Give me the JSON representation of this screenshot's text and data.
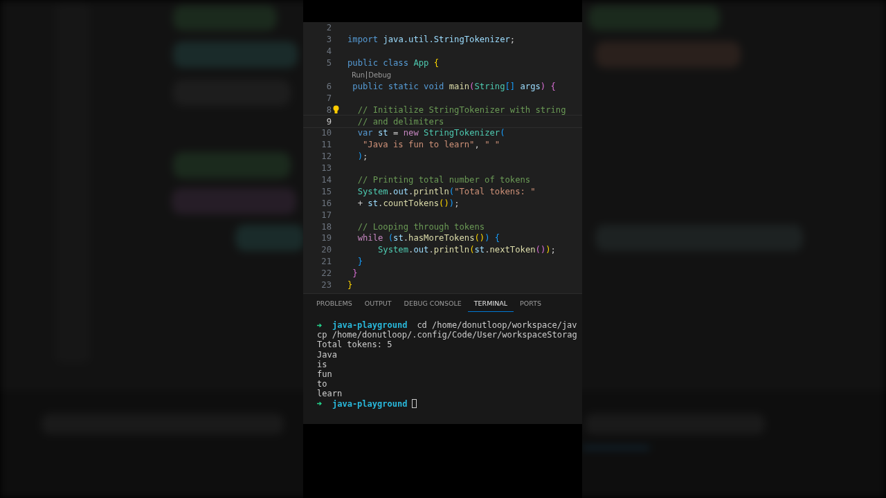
{
  "editor": {
    "lines": [
      {
        "number": "2",
        "current": false
      },
      {
        "number": "3",
        "current": false,
        "tokens": [
          {
            "kind": "keyword",
            "text": "import "
          },
          {
            "kind": "variable",
            "text": "java.util.StringTokenizer"
          },
          {
            "kind": "plain",
            "text": ";"
          }
        ]
      },
      {
        "number": "4",
        "current": false
      },
      {
        "number": "5",
        "current": false,
        "tokens": [
          {
            "kind": "keyword",
            "text": "public class "
          },
          {
            "kind": "class",
            "text": "App "
          },
          {
            "kind": "bracket1",
            "text": "{"
          }
        ]
      },
      {
        "number": "6",
        "current": false,
        "lens": [
          "Run",
          "Debug"
        ],
        "tokens": [
          {
            "kind": "keyword",
            "text": " public static void "
          },
          {
            "kind": "function",
            "text": "main"
          },
          {
            "kind": "bracket2",
            "text": "("
          },
          {
            "kind": "class",
            "text": "String"
          },
          {
            "kind": "bracket3",
            "text": "[] "
          },
          {
            "kind": "variable",
            "text": "args"
          },
          {
            "kind": "bracket2",
            "text": ") {"
          }
        ]
      },
      {
        "number": "7",
        "current": false
      },
      {
        "number": "8",
        "current": false,
        "hint": true,
        "tokens": [
          {
            "kind": "comment",
            "text": "  // Initialize StringTokenizer with string"
          }
        ]
      },
      {
        "number": "9",
        "current": true,
        "tokens": [
          {
            "kind": "comment",
            "text": "  // and delimiters"
          }
        ]
      },
      {
        "number": "10",
        "current": false,
        "tokens": [
          {
            "kind": "keyword",
            "text": "  var "
          },
          {
            "kind": "variable",
            "text": "st"
          },
          {
            "kind": "plain",
            "text": " = "
          },
          {
            "kind": "control",
            "text": "new "
          },
          {
            "kind": "class",
            "text": "StringTokenizer"
          },
          {
            "kind": "bracket3",
            "text": "("
          }
        ]
      },
      {
        "number": "11",
        "current": false,
        "tokens": [
          {
            "kind": "string",
            "text": "   \"Java is fun to learn\""
          },
          {
            "kind": "plain",
            "text": ", "
          },
          {
            "kind": "string",
            "text": "\" \""
          }
        ]
      },
      {
        "number": "12",
        "current": false,
        "tokens": [
          {
            "kind": "bracket3",
            "text": "  )"
          },
          {
            "kind": "plain",
            "text": ";"
          }
        ]
      },
      {
        "number": "13",
        "current": false
      },
      {
        "number": "14",
        "current": false,
        "tokens": [
          {
            "kind": "comment",
            "text": "  // Printing total number of tokens"
          }
        ]
      },
      {
        "number": "15",
        "current": false,
        "tokens": [
          {
            "kind": "class",
            "text": "  System"
          },
          {
            "kind": "plain",
            "text": "."
          },
          {
            "kind": "variable",
            "text": "out"
          },
          {
            "kind": "plain",
            "text": "."
          },
          {
            "kind": "function",
            "text": "println"
          },
          {
            "kind": "bracket3",
            "text": "("
          },
          {
            "kind": "string",
            "text": "\"Total tokens: \""
          }
        ]
      },
      {
        "number": "16",
        "current": false,
        "tokens": [
          {
            "kind": "plain",
            "text": "  + "
          },
          {
            "kind": "variable",
            "text": "st"
          },
          {
            "kind": "plain",
            "text": "."
          },
          {
            "kind": "function",
            "text": "countTokens"
          },
          {
            "kind": "bracket1",
            "text": "()"
          },
          {
            "kind": "bracket3",
            "text": ")"
          },
          {
            "kind": "plain",
            "text": ";"
          }
        ]
      },
      {
        "number": "17",
        "current": false
      },
      {
        "number": "18",
        "current": false,
        "tokens": [
          {
            "kind": "comment",
            "text": "  // Looping through tokens"
          }
        ]
      },
      {
        "number": "19",
        "current": false,
        "tokens": [
          {
            "kind": "control",
            "text": "  while "
          },
          {
            "kind": "bracket3",
            "text": "("
          },
          {
            "kind": "variable",
            "text": "st"
          },
          {
            "kind": "plain",
            "text": "."
          },
          {
            "kind": "function",
            "text": "hasMoreTokens"
          },
          {
            "kind": "bracket1",
            "text": "()"
          },
          {
            "kind": "bracket3",
            "text": ") {"
          }
        ]
      },
      {
        "number": "20",
        "current": false,
        "tokens": [
          {
            "kind": "class",
            "text": "      System"
          },
          {
            "kind": "plain",
            "text": "."
          },
          {
            "kind": "variable",
            "text": "out"
          },
          {
            "kind": "plain",
            "text": "."
          },
          {
            "kind": "function",
            "text": "println"
          },
          {
            "kind": "bracket1",
            "text": "("
          },
          {
            "kind": "variable",
            "text": "st"
          },
          {
            "kind": "plain",
            "text": "."
          },
          {
            "kind": "function",
            "text": "nextToken"
          },
          {
            "kind": "bracket2",
            "text": "()"
          },
          {
            "kind": "bracket1",
            "text": ")"
          },
          {
            "kind": "plain",
            "text": ";"
          }
        ]
      },
      {
        "number": "21",
        "current": false,
        "tokens": [
          {
            "kind": "bracket3",
            "text": "  }"
          }
        ]
      },
      {
        "number": "22",
        "current": false,
        "tokens": [
          {
            "kind": "bracket2",
            "text": " }"
          }
        ]
      },
      {
        "number": "23",
        "current": false,
        "tokens": [
          {
            "kind": "bracket1",
            "text": "}"
          }
        ]
      }
    ]
  },
  "panel": {
    "tabs": [
      {
        "label": "PROBLEMS",
        "selected": false
      },
      {
        "label": "OUTPUT",
        "selected": false
      },
      {
        "label": "DEBUG CONSOLE",
        "selected": false
      },
      {
        "label": "TERMINAL",
        "selected": true
      },
      {
        "label": "PORTS",
        "selected": false
      }
    ],
    "terminal": [
      {
        "kind": "prompt",
        "folder": "java-playground",
        "command": "cd /home/donutloop/workspace/jav"
      },
      {
        "kind": "output",
        "text": "cp /home/donutloop/.config/Code/User/workspaceStorag"
      },
      {
        "kind": "output",
        "text": "Total tokens: 5"
      },
      {
        "kind": "output",
        "text": "Java"
      },
      {
        "kind": "output",
        "text": "is"
      },
      {
        "kind": "output",
        "text": "fun"
      },
      {
        "kind": "output",
        "text": "to"
      },
      {
        "kind": "output",
        "text": "learn"
      },
      {
        "kind": "prompt",
        "folder": "java-playground",
        "cursor": true
      }
    ]
  }
}
